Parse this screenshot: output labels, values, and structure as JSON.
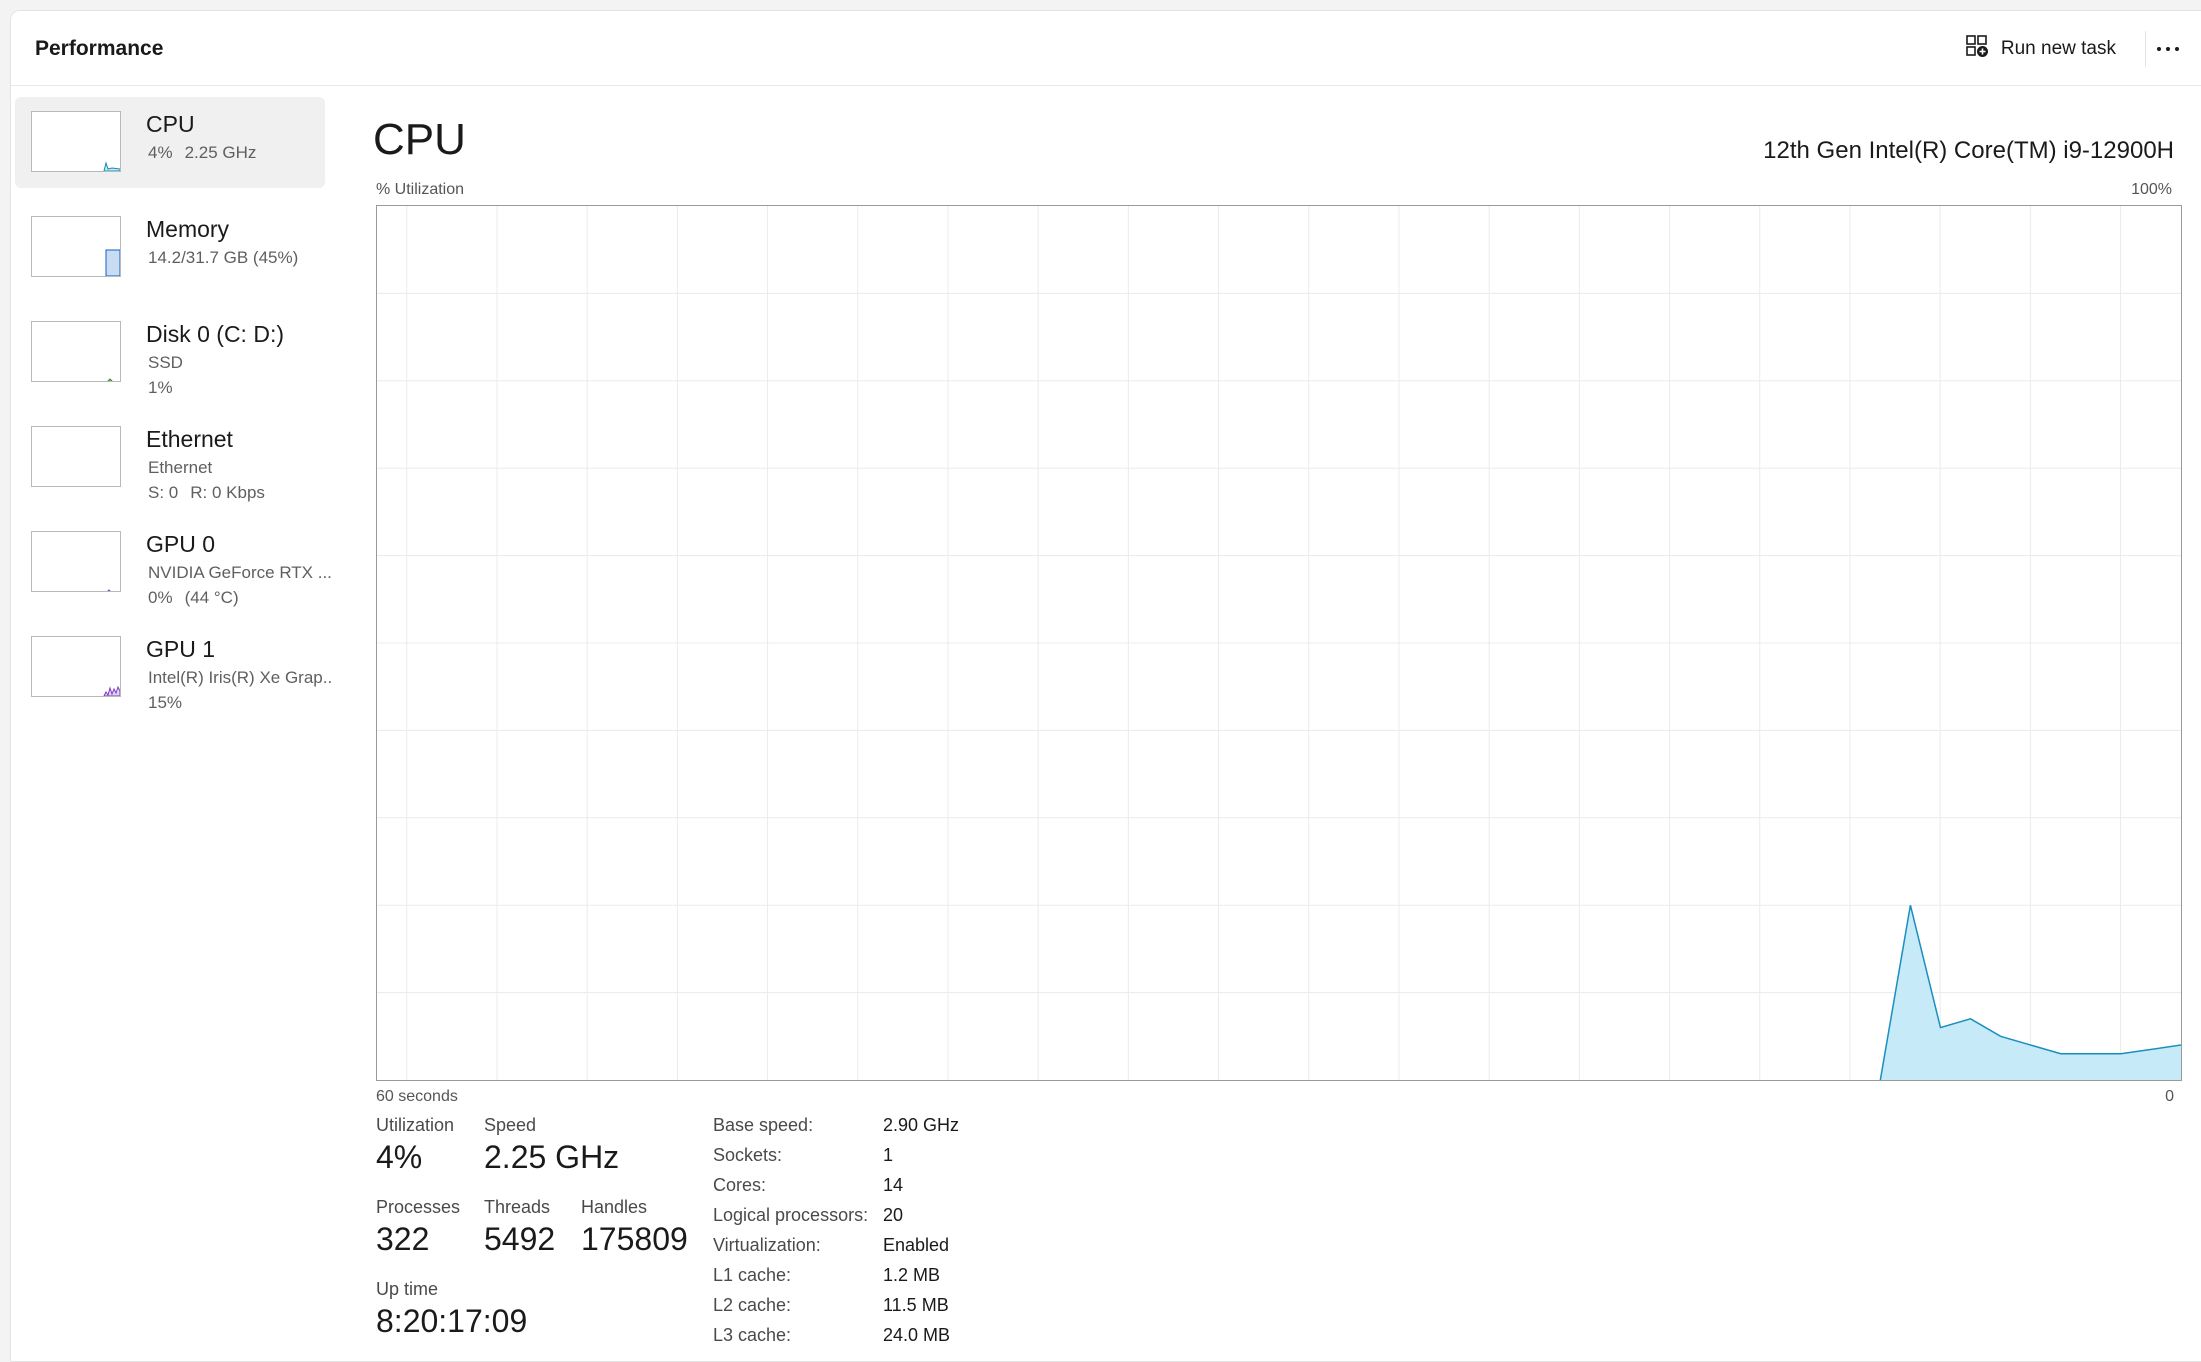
{
  "header": {
    "title": "Performance",
    "run_new_task_label": "Run new task"
  },
  "sidebar": {
    "items": [
      {
        "name": "CPU",
        "sub1a": "4%",
        "sub1b": "2.25 GHz",
        "selected": true,
        "level": 0.04,
        "color": "#118ab8"
      },
      {
        "name": "Memory",
        "sub1": "14.2/31.7 GB (45%)",
        "level": 0.45,
        "color": "#0b63c4"
      },
      {
        "name": "Disk 0 (C: D:)",
        "sub1": "SSD",
        "sub2": "1%",
        "level": 0.01,
        "color": "#4e8b2c"
      },
      {
        "name": "Ethernet",
        "sub1": "Ethernet",
        "sub2a": "S: 0",
        "sub2b": "R: 0 Kbps",
        "level": 0,
        "color": "#a3600e"
      },
      {
        "name": "GPU 0",
        "sub1": "NVIDIA GeForce RTX ...",
        "sub2a": "0%",
        "sub2b": "(44 °C)",
        "level": 0,
        "color": "#7a3cc1"
      },
      {
        "name": "GPU 1",
        "sub1": "Intel(R) Iris(R) Xe Grap...",
        "sub2": "15%",
        "level": 0.15,
        "color": "#7a3cc1"
      }
    ]
  },
  "main": {
    "title": "CPU",
    "model": "12th Gen Intel(R) Core(TM) i9-12900H",
    "y_axis_label": "% Utilization",
    "y_axis_max": "100%",
    "x_axis_left": "60 seconds",
    "x_axis_right": "0"
  },
  "chart_data": {
    "type": "area",
    "x": [
      60,
      58,
      56,
      54,
      52,
      50,
      48,
      46,
      44,
      42,
      40,
      38,
      36,
      34,
      32,
      30,
      28,
      26,
      24,
      22,
      20,
      18,
      16,
      14,
      12,
      10,
      8,
      6,
      4,
      2,
      0
    ],
    "values": [
      0,
      0,
      0,
      0,
      0,
      0,
      0,
      0,
      0,
      0,
      0,
      0,
      0,
      0,
      0,
      0,
      0,
      0,
      0,
      0,
      0,
      0,
      0,
      0,
      0,
      0,
      0,
      0,
      0,
      0,
      0
    ],
    "tail": [
      {
        "t": 10,
        "v": 0
      },
      {
        "t": 9,
        "v": 20
      },
      {
        "t": 8,
        "v": 6
      },
      {
        "t": 7,
        "v": 7
      },
      {
        "t": 6,
        "v": 5
      },
      {
        "t": 5,
        "v": 4
      },
      {
        "t": 4,
        "v": 3
      },
      {
        "t": 3,
        "v": 3
      },
      {
        "t": 2,
        "v": 3
      },
      {
        "t": 0,
        "v": 4
      }
    ],
    "ylim": [
      0,
      100
    ],
    "xlim": [
      60,
      0
    ],
    "grid": true,
    "grid_rows": 10,
    "grid_cols": 20,
    "fill_color": "#c6eaf7",
    "line_color": "#1b8ebf"
  },
  "stats": {
    "utilization_label": "Utilization",
    "utilization_value": "4%",
    "speed_label": "Speed",
    "speed_value": "2.25 GHz",
    "processes_label": "Processes",
    "processes_value": "322",
    "threads_label": "Threads",
    "threads_value": "5492",
    "handles_label": "Handles",
    "handles_value": "175809",
    "uptime_label": "Up time",
    "uptime_value": "8:20:17:09"
  },
  "specs": [
    {
      "k": "Base speed:",
      "v": "2.90 GHz"
    },
    {
      "k": "Sockets:",
      "v": "1"
    },
    {
      "k": "Cores:",
      "v": "14"
    },
    {
      "k": "Logical processors:",
      "v": "20"
    },
    {
      "k": "Virtualization:",
      "v": "Enabled"
    },
    {
      "k": "L1 cache:",
      "v": "1.2 MB"
    },
    {
      "k": "L2 cache:",
      "v": "11.5 MB"
    },
    {
      "k": "L3 cache:",
      "v": "24.0 MB"
    }
  ],
  "icons": {
    "run_task": "run-task-icon",
    "more": "more-options-icon"
  }
}
